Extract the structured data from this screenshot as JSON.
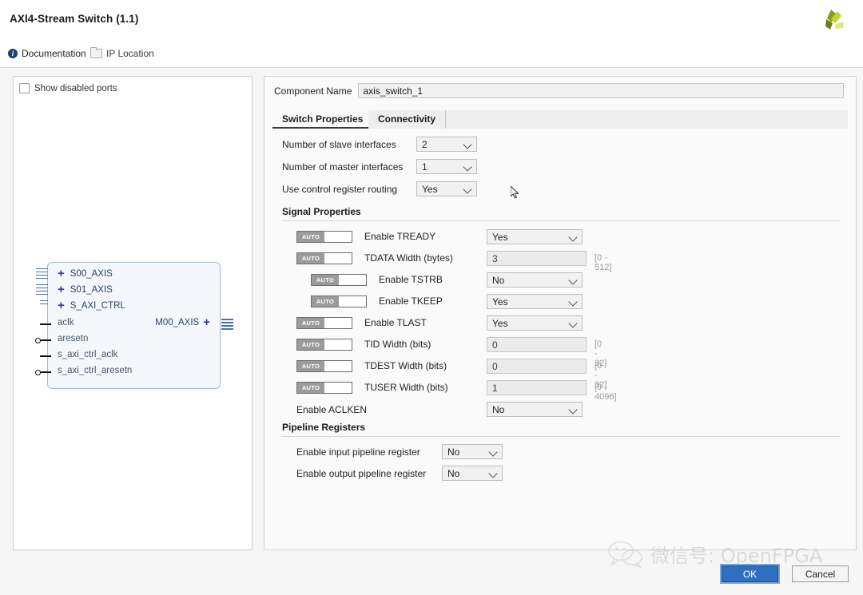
{
  "window": {
    "title": "AXI4-Stream Switch (1.1)",
    "logo_icon": "xilinx-pinwheel-logo",
    "logo_colors": [
      "#8a9a1e",
      "#c2d22a",
      "#e6ee9c"
    ]
  },
  "linkbar": {
    "documentation": {
      "label": "Documentation",
      "icon": "info-icon"
    },
    "ip_location": {
      "label": "IP Location",
      "icon": "folder-icon"
    }
  },
  "diagram": {
    "show_disabled_ports": {
      "label": "Show disabled ports",
      "checked": false
    },
    "input_ports": [
      {
        "name": "S00_AXIS",
        "type": "bus"
      },
      {
        "name": "S01_AXIS",
        "type": "bus"
      },
      {
        "name": "S_AXI_CTRL",
        "type": "bus"
      },
      {
        "name": "aclk",
        "type": "signal"
      },
      {
        "name": "aresetn",
        "type": "signal-inverted"
      },
      {
        "name": "s_axi_ctrl_aclk",
        "type": "signal"
      },
      {
        "name": "s_axi_ctrl_aresetn",
        "type": "signal-inverted"
      }
    ],
    "output_ports": [
      {
        "name": "M00_AXIS",
        "type": "bus"
      }
    ]
  },
  "component": {
    "label": "Component Name",
    "value": "axis_switch_1"
  },
  "tabs": [
    {
      "label": "Switch Properties",
      "active": true
    },
    {
      "label": "Connectivity",
      "active": false
    }
  ],
  "switch_properties": {
    "top_fields": [
      {
        "label": "Number of slave interfaces",
        "value": "2"
      },
      {
        "label": "Number of master interfaces",
        "value": "1"
      },
      {
        "label": "Use control register routing",
        "value": "Yes"
      }
    ],
    "signal_properties": {
      "header": "Signal Properties",
      "auto_badge": "AUTO",
      "rows": [
        {
          "label": "Enable TREADY",
          "auto": true,
          "indent": 0,
          "control": "select",
          "value": "Yes",
          "hint": ""
        },
        {
          "label": "TDATA Width (bytes)",
          "auto": true,
          "indent": 0,
          "control": "text",
          "value": "3",
          "hint": "[0 - 512]"
        },
        {
          "label": "Enable TSTRB",
          "auto": true,
          "indent": 1,
          "control": "select",
          "value": "No",
          "hint": ""
        },
        {
          "label": "Enable TKEEP",
          "auto": true,
          "indent": 1,
          "control": "select",
          "value": "Yes",
          "hint": ""
        },
        {
          "label": "Enable TLAST",
          "auto": true,
          "indent": 0,
          "control": "select",
          "value": "Yes",
          "hint": ""
        },
        {
          "label": "TID Width (bits)",
          "auto": true,
          "indent": 0,
          "control": "text",
          "value": "0",
          "hint": "[0 - 32]"
        },
        {
          "label": "TDEST Width (bits)",
          "auto": true,
          "indent": 0,
          "control": "text",
          "value": "0",
          "hint": "[0 - 32]"
        },
        {
          "label": "TUSER Width (bits)",
          "auto": true,
          "indent": 0,
          "control": "text",
          "value": "1",
          "hint": "[0 - 4096]"
        },
        {
          "label": "Enable ACLKEN",
          "auto": false,
          "indent": 0,
          "control": "select",
          "value": "No",
          "hint": ""
        }
      ]
    },
    "pipeline_registers": {
      "header": "Pipeline Registers",
      "rows": [
        {
          "label": "Enable input pipeline register",
          "value": "No"
        },
        {
          "label": "Enable output pipeline register",
          "value": "No"
        }
      ]
    }
  },
  "buttons": {
    "ok": "OK",
    "cancel": "Cancel"
  },
  "watermark": {
    "text": "微信号: OpenFPGA",
    "icon": "wechat-bubble-icon"
  }
}
